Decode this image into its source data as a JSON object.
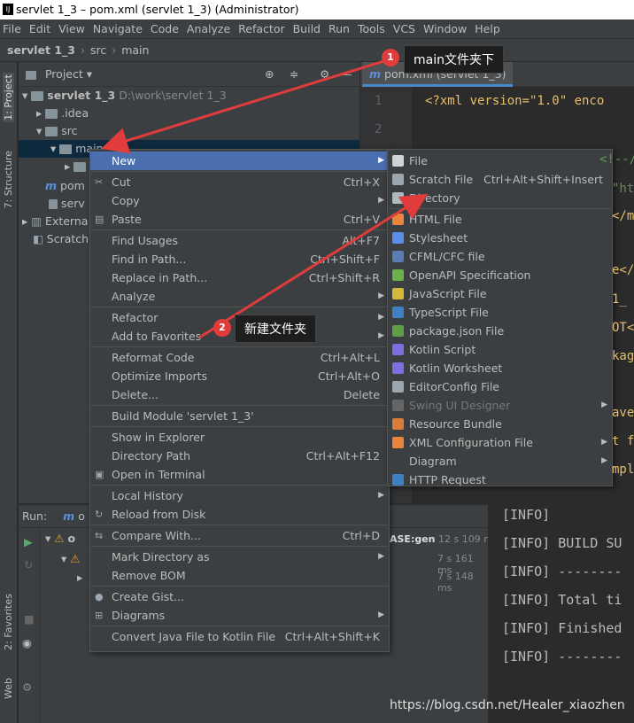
{
  "window_title": "servlet 1_3 – pom.xml (servlet 1_3) (Administrator)",
  "menu_bar": [
    "File",
    "Edit",
    "View",
    "Navigate",
    "Code",
    "Analyze",
    "Refactor",
    "Build",
    "Run",
    "Tools",
    "VCS",
    "Window",
    "Help"
  ],
  "breadcrumb": [
    "servlet 1_3",
    "src",
    "main"
  ],
  "project_panel": {
    "title": "Project",
    "items": [
      {
        "label": "servlet 1_3",
        "path": "D:\\work\\servlet 1_3"
      },
      {
        "label": ".idea"
      },
      {
        "label": "src"
      },
      {
        "label": "main"
      },
      {
        "label": "pom"
      },
      {
        "label": "serv"
      },
      {
        "label": "Externa"
      },
      {
        "label": "Scratch"
      }
    ]
  },
  "left_strip": [
    "1: Project",
    "7: Structure",
    "2: Favorites",
    "Web"
  ],
  "editor": {
    "tab": "pom.xml (servlet 1_3)",
    "lines": [
      "1",
      "2"
    ],
    "code": "<?xml version=\"1.0\" enco",
    "frag": [
      "<!--//m",
      "\"ht",
      "</m",
      "e</",
      "1_",
      "OT<",
      "kag",
      "ave",
      "t f",
      "mpl"
    ]
  },
  "run": {
    "label": "Run:",
    "tab": "o",
    "rows": [
      {
        "t": "o",
        "time": "12 s 109 ms",
        "tag": "ASE:gen"
      },
      {
        "t": "",
        "time": "7 s 161 ms"
      },
      {
        "t": "",
        "time": "7 s 148 ms"
      }
    ]
  },
  "console": [
    "[INFO]",
    "[INFO] BUILD SU",
    "[INFO] --------",
    "[INFO] Total ti",
    "[INFO] Finished",
    "[INFO] --------"
  ],
  "context_menu": [
    {
      "label": "New",
      "sub": true,
      "sel": true
    },
    {
      "sep": true
    },
    {
      "label": "Cut",
      "sc": "Ctrl+X",
      "icon": "cut-icon"
    },
    {
      "label": "Copy",
      "sub": true
    },
    {
      "label": "Paste",
      "sc": "Ctrl+V",
      "icon": "paste-icon"
    },
    {
      "sep": true
    },
    {
      "label": "Find Usages",
      "sc": "Alt+F7"
    },
    {
      "label": "Find in Path...",
      "sc": "Ctrl+Shift+F"
    },
    {
      "label": "Replace in Path...",
      "sc": "Ctrl+Shift+R"
    },
    {
      "label": "Analyze",
      "sub": true
    },
    {
      "sep": true
    },
    {
      "label": "Refactor",
      "sub": true
    },
    {
      "label": "Add to Favorites",
      "sub": true
    },
    {
      "sep": true
    },
    {
      "label": "Reformat Code",
      "sc": "Ctrl+Alt+L"
    },
    {
      "label": "Optimize Imports",
      "sc": "Ctrl+Alt+O"
    },
    {
      "label": "Delete...",
      "sc": "Delete"
    },
    {
      "sep": true
    },
    {
      "label": "Build Module 'servlet 1_3'"
    },
    {
      "sep": true
    },
    {
      "label": "Show in Explorer"
    },
    {
      "label": "Directory Path",
      "sc": "Ctrl+Alt+F12"
    },
    {
      "label": "Open in Terminal",
      "icon": "terminal-icon"
    },
    {
      "sep": true
    },
    {
      "label": "Local History",
      "sub": true
    },
    {
      "label": "Reload from Disk",
      "icon": "reload-icon"
    },
    {
      "sep": true
    },
    {
      "label": "Compare With...",
      "sc": "Ctrl+D",
      "icon": "compare-icon"
    },
    {
      "sep": true
    },
    {
      "label": "Mark Directory as",
      "sub": true
    },
    {
      "label": "Remove BOM"
    },
    {
      "sep": true
    },
    {
      "label": "Create Gist...",
      "icon": "github-icon"
    },
    {
      "label": "Diagrams",
      "sub": true,
      "icon": "diagram-icon"
    },
    {
      "sep": true
    },
    {
      "label": "Convert Java File to Kotlin File",
      "sc": "Ctrl+Alt+Shift+K"
    }
  ],
  "new_submenu": [
    {
      "label": "File",
      "color": "#cfd3d6"
    },
    {
      "label": "Scratch File",
      "sc": "Ctrl+Alt+Shift+Insert",
      "color": "#9aa7b0"
    },
    {
      "label": "Directory",
      "color": "#aeb9c0"
    },
    {
      "sep": true
    },
    {
      "label": "HTML File",
      "color": "#e8843b"
    },
    {
      "label": "Stylesheet",
      "color": "#5a8ee8"
    },
    {
      "label": "CFML/CFC file",
      "color": "#5b7db3"
    },
    {
      "label": "OpenAPI Specification",
      "color": "#6ab04c"
    },
    {
      "label": "JavaScript File",
      "color": "#d4b83a"
    },
    {
      "label": "TypeScript File",
      "color": "#3f7fc4"
    },
    {
      "label": "package.json File",
      "color": "#5f9e49"
    },
    {
      "label": "Kotlin Script",
      "color": "#7f6ee0"
    },
    {
      "label": "Kotlin Worksheet",
      "color": "#7f6ee0"
    },
    {
      "label": "EditorConfig File",
      "color": "#9aa7b0"
    },
    {
      "label": "Swing UI Designer",
      "sub": true,
      "dis": true,
      "color": "#666"
    },
    {
      "label": "Resource Bundle",
      "color": "#d97c3a"
    },
    {
      "label": "XML Configuration File",
      "sub": true,
      "color": "#e8843b"
    },
    {
      "label": "Diagram",
      "sub": true,
      "color": "#3c3f41"
    },
    {
      "label": "HTTP Request",
      "color": "#3f7fc4"
    }
  ],
  "callouts": [
    {
      "num": "1",
      "text": "main文件夹下"
    },
    {
      "num": "2",
      "text": "新建文件夹"
    }
  ],
  "watermark": "https://blog.csdn.net/Healer_xiaozhen"
}
